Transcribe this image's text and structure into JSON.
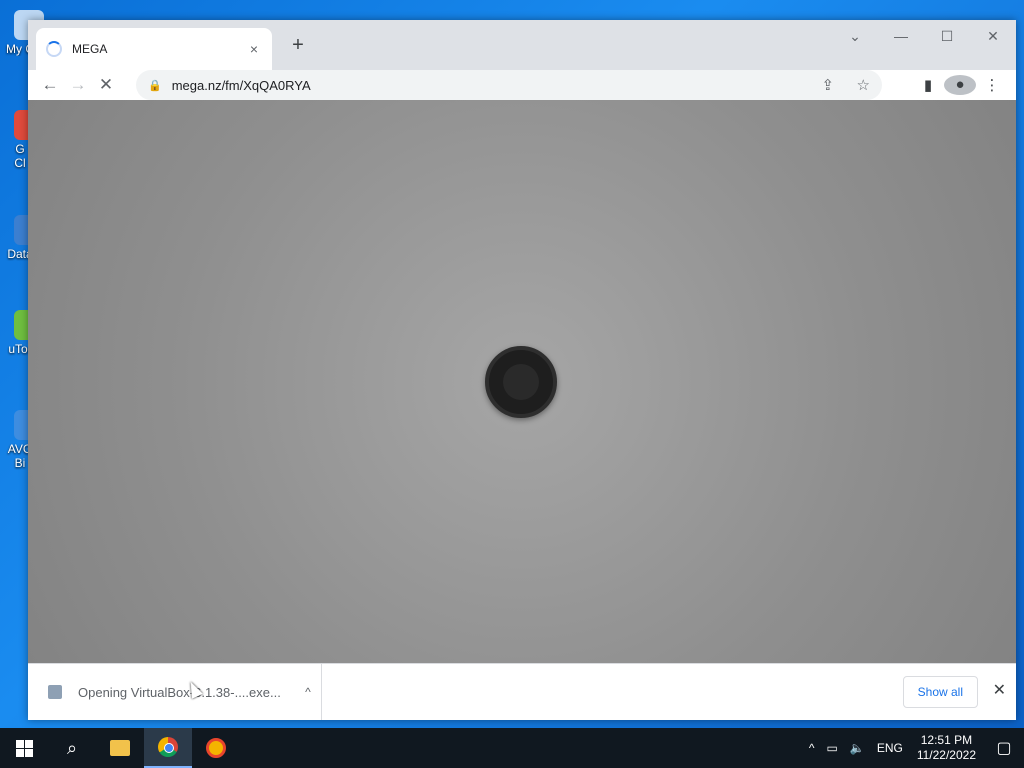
{
  "desktop": {
    "icons": [
      {
        "label": "My C"
      },
      {
        "label": "G"
      },
      {
        "label": "Cl"
      },
      {
        "label": "Data"
      },
      {
        "label": "uTor"
      },
      {
        "label": "AVG"
      },
      {
        "label": "Bi"
      }
    ]
  },
  "browser": {
    "tab": {
      "title": "MEGA",
      "close": "×"
    },
    "new_tab": "+",
    "window_controls": {
      "dropdown": "⌄",
      "minimize": "—",
      "maximize": "☐",
      "close": "✕"
    },
    "toolbar": {
      "back": "←",
      "forward": "→",
      "stop": "✕"
    },
    "omnibox": {
      "url": "mega.nz/fm/XqQA0RYA",
      "lock": "🔒"
    },
    "icons": {
      "share": "⇪",
      "bookmark": "☆",
      "sidepanel": "▮",
      "profile": "●",
      "menu": "⋮"
    }
  },
  "download_bar": {
    "item_text": "Opening VirtualBox-6.1.38-....exe...",
    "chevron": "^",
    "show_all": "Show all",
    "close": "✕"
  },
  "taskbar": {
    "search": "⌕",
    "tray": {
      "arrow": "^",
      "network": "▭",
      "volume": "🔈",
      "lang": "ENG",
      "time": "12:51 PM",
      "date": "11/22/2022",
      "notif": "▢"
    }
  }
}
